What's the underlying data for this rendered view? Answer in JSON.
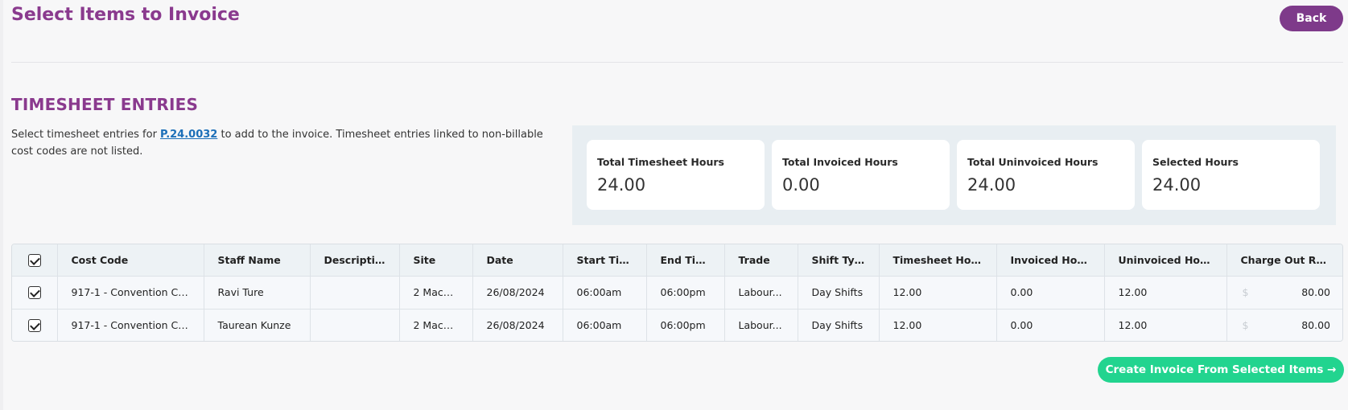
{
  "header": {
    "title": "Select Items to Invoice",
    "back_label": "Back"
  },
  "section": {
    "title": "TIMESHEET ENTRIES",
    "intro_before": "Select timesheet entries for ",
    "project_link": "P.24.0032",
    "intro_after": " to add to the invoice. Timesheet entries linked to non-billable cost codes are not listed."
  },
  "stats": [
    {
      "label": "Total Timesheet Hours",
      "value": "24.00"
    },
    {
      "label": "Total Invoiced Hours",
      "value": "0.00"
    },
    {
      "label": "Total Uninvoiced Hours",
      "value": "24.00"
    },
    {
      "label": "Selected Hours",
      "value": "24.00"
    }
  ],
  "table": {
    "columns": [
      "Cost Code",
      "Staff Name",
      "Description",
      "Site",
      "Date",
      "Start Time",
      "End Time",
      "Trade",
      "Shift Type",
      "Timesheet Hours",
      "Invoiced Hours",
      "Uninvoiced Hours",
      "Charge Out Rate"
    ],
    "currency_symbol": "$",
    "rows": [
      {
        "cost_code": "917-1 - Convention Ce...",
        "staff_name": "Ravi Ture",
        "description": "",
        "site": "2 Mack...",
        "date": "26/08/2024",
        "start_time": "06:00am",
        "end_time": "06:00pm",
        "trade": "Labour...",
        "shift_type": "Day Shifts",
        "timesheet_hours": "12.00",
        "invoiced_hours": "0.00",
        "uninvoiced_hours": "12.00",
        "charge_out_rate": "80.00"
      },
      {
        "cost_code": "917-1 - Convention Ce...",
        "staff_name": "Taurean Kunze",
        "description": "",
        "site": "2 Mack...",
        "date": "26/08/2024",
        "start_time": "06:00am",
        "end_time": "06:00pm",
        "trade": "Labour...",
        "shift_type": "Day Shifts",
        "timesheet_hours": "12.00",
        "invoiced_hours": "0.00",
        "uninvoiced_hours": "12.00",
        "charge_out_rate": "80.00"
      }
    ]
  },
  "footer": {
    "create_label": "Create Invoice From Selected Items →"
  },
  "colors": {
    "brand_purple": "#7e3a8a",
    "title_purple": "#8a3a8e",
    "accent_green": "#22d48f",
    "link_blue": "#1c6fb8"
  }
}
